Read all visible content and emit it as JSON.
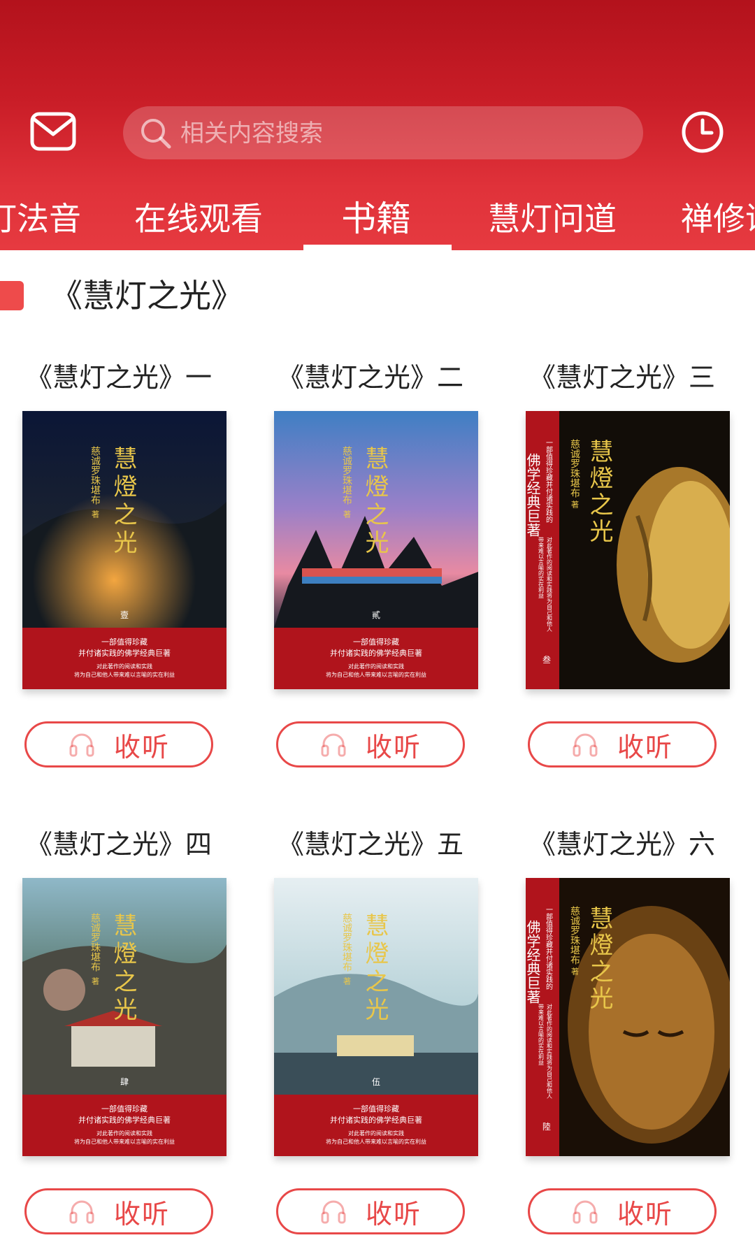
{
  "header": {
    "search_placeholder": "相关内容搜索",
    "tabs": [
      {
        "label": "灯法音",
        "active": false
      },
      {
        "label": "在线观看",
        "active": false
      },
      {
        "label": "书籍",
        "active": true
      },
      {
        "label": "慧灯问道",
        "active": false
      },
      {
        "label": "禅修课",
        "active": false
      }
    ]
  },
  "section": {
    "title": "《慧灯之光》"
  },
  "books": [
    {
      "title": "《慧灯之光》一",
      "cover": {
        "author": "慈诚罗珠堪布",
        "author_mark": "著",
        "book_name": "慧燈之光",
        "volume": "壹",
        "tagline": "一部值得珍藏",
        "tagline2": "并付诸实践的佛学经典巨著",
        "blurb": "对此著作的阅读和实践",
        "blurb2": "将为自己和他人带来难以言喻的实在利益",
        "theme": "night-city"
      },
      "listen_label": "收听"
    },
    {
      "title": "《慧灯之光》二",
      "cover": {
        "author": "慈诚罗珠堪布",
        "author_mark": "著",
        "book_name": "慧燈之光",
        "volume": "貳",
        "tagline": "一部值得珍藏",
        "tagline2": "并付诸实践的佛学经典巨著",
        "blurb": "对此著作的阅读和实践",
        "blurb2": "将为自己和他人带来难以言喻的实在利益",
        "theme": "sunset-prayer-flags"
      },
      "listen_label": "收听"
    },
    {
      "title": "《慧灯之光》三",
      "cover": {
        "author": "慈诚罗珠堪布",
        "author_mark": "著",
        "book_name": "慧燈之光",
        "volume": "叁",
        "side_title": "佛学经典巨著",
        "side_tagline": "一部值得珍藏并付诸实践的",
        "blurb": "对此著作的阅读和实践将为自己和他人",
        "blurb2": "带来难以言喻的实在利益",
        "theme": "golden-buddha"
      },
      "listen_label": "收听"
    },
    {
      "title": "《慧灯之光》四",
      "cover": {
        "author": "慈诚罗珠堪布",
        "author_mark": "著",
        "book_name": "慧燈之光",
        "volume": "肆",
        "tagline": "一部值得珍藏",
        "tagline2": "并付诸实践的佛学经典巨著",
        "blurb": "对此著作的阅读和实践",
        "blurb2": "将为自己和他人带来难以言喻的实在利益",
        "theme": "monastery-valley"
      },
      "listen_label": "收听"
    },
    {
      "title": "《慧灯之光》五",
      "cover": {
        "author": "慈诚罗珠堪布",
        "author_mark": "著",
        "book_name": "慧燈之光",
        "volume": "伍",
        "tagline": "一部值得珍藏",
        "tagline2": "并付诸实践的佛学经典巨著",
        "blurb": "对此著作的阅读和实践",
        "blurb2": "将为自己和他人带来难以言喻的实在利益",
        "theme": "misty-monastery"
      },
      "listen_label": "收听"
    },
    {
      "title": "《慧灯之光》六",
      "cover": {
        "author": "慈诚罗珠堪布",
        "author_mark": "著",
        "book_name": "慧燈之光",
        "volume": "陸",
        "side_title": "佛学经典巨著",
        "side_tagline": "一部值得珍藏并付诸实践的",
        "blurb": "对此著作的阅读和实践将为自己和他人",
        "blurb2": "带来难以言喻的实在利益",
        "theme": "bronze-buddha"
      },
      "listen_label": "收听"
    }
  ],
  "colors": {
    "header_red": "#c91d27",
    "accent_red": "#e84848",
    "cover_red": "#b0141c",
    "title_gold": "#e8c64a"
  }
}
